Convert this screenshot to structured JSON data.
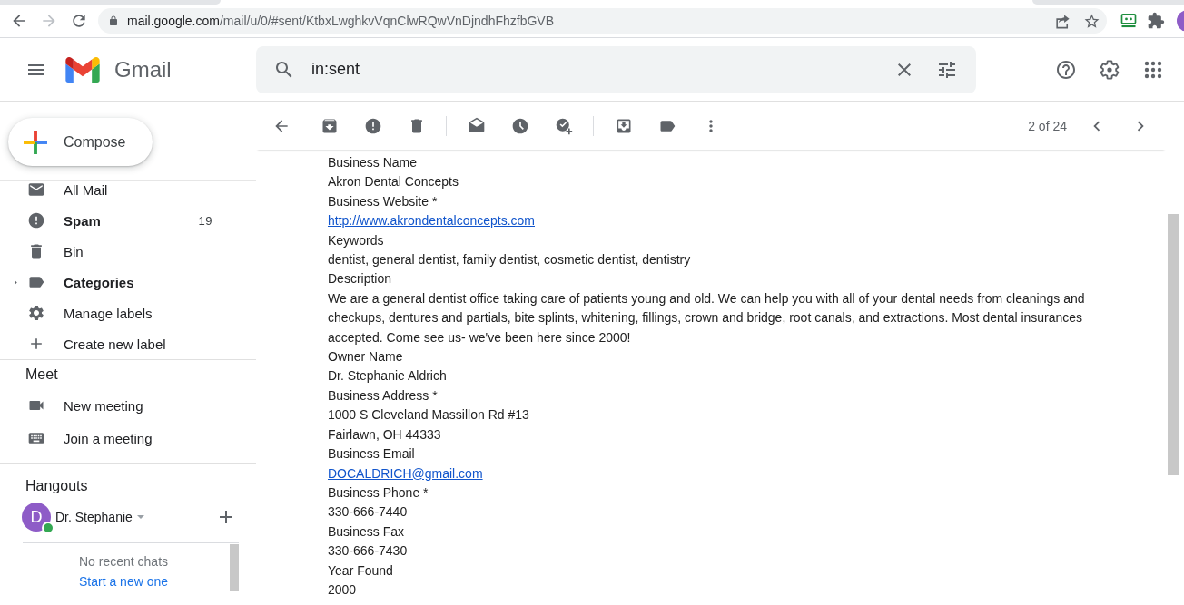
{
  "browser": {
    "back_enabled": true,
    "forward_enabled": false,
    "url_host": "mail.google.com",
    "url_path": "/mail/u/0/#sent/KtbxLwghkvVqnClwRQwVnDjndhFhzfbGVB",
    "bookmarked": false
  },
  "header": {
    "app_name": "Gmail",
    "search": {
      "value": "in:sent"
    }
  },
  "compose": {
    "label": "Compose"
  },
  "sidebar": {
    "items": [
      {
        "label": "All Mail",
        "bold": false
      },
      {
        "label": "Spam",
        "bold": true,
        "count": "19"
      },
      {
        "label": "Bin",
        "bold": false
      },
      {
        "label": "Categories",
        "bold": true,
        "expanded": false
      },
      {
        "label": "Manage labels",
        "bold": false
      },
      {
        "label": "Create new label",
        "bold": false
      }
    ]
  },
  "meet": {
    "title": "Meet",
    "items": [
      {
        "label": "New meeting"
      },
      {
        "label": "Join a meeting"
      }
    ]
  },
  "hangouts": {
    "title": "Hangouts",
    "user": {
      "initial": "D",
      "name": "Dr. Stephanie",
      "online": true
    },
    "empty_text": "No recent chats",
    "action_link": "Start a new one"
  },
  "toolbar": {
    "pager": "2 of 24"
  },
  "message": {
    "fields": [
      {
        "label": "Business Name",
        "values": [
          "Akron Dental Concepts"
        ],
        "link": false
      },
      {
        "label": "Business Website *",
        "values": [
          "http://www.akrondentalconcepts.com"
        ],
        "link": true
      },
      {
        "label": "Keywords",
        "values": [
          "dentist, general dentist, family dentist, cosmetic dentist, dentistry"
        ],
        "link": false
      },
      {
        "label": "Description",
        "values": [
          "We are a general dentist office taking care of patients young and old. We can help you with all of your dental needs from cleanings and checkups, dentures and partials, bite splints, whitening, fillings, crown and bridge, root canals, and extractions. Most dental insurances accepted. Come see us- we've been here since 2000!"
        ],
        "link": false
      },
      {
        "label": "Owner Name",
        "values": [
          "Dr. Stephanie Aldrich"
        ],
        "link": false
      },
      {
        "label": "Business Address *",
        "values": [
          "1000 S Cleveland Massillon Rd #13",
          "Fairlawn, OH 44333"
        ],
        "link": false
      },
      {
        "label": "Business Email",
        "values": [
          "DOCALDRICH@gmail.com"
        ],
        "link": true
      },
      {
        "label": "Business Phone *",
        "values": [
          "330-666-7440"
        ],
        "link": false
      },
      {
        "label": "Business Fax",
        "values": [
          "330-666-7430"
        ],
        "link": false
      },
      {
        "label": "Year Found",
        "values": [
          "2000"
        ],
        "link": false
      }
    ]
  }
}
